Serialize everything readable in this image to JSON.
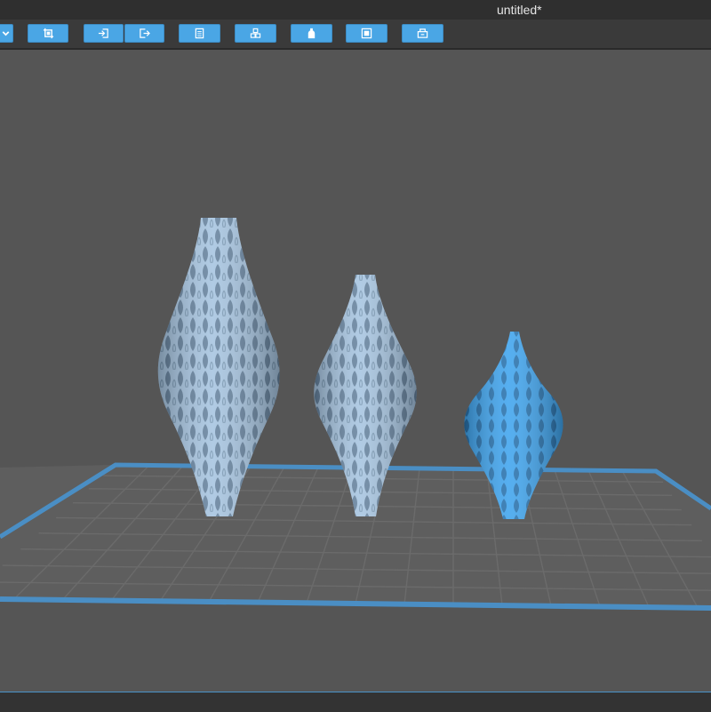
{
  "window": {
    "title": "untitled*"
  },
  "toolbar": {
    "buttons": [
      {
        "name": "dropdown-toggle-button",
        "icon": "chevron-down-icon"
      },
      {
        "name": "crop-button",
        "icon": "crop-icon"
      },
      {
        "name": "import-button",
        "icon": "import-icon"
      },
      {
        "name": "export-button",
        "icon": "export-icon"
      },
      {
        "name": "notes-button",
        "icon": "document-icon"
      },
      {
        "name": "arrange-button",
        "icon": "cubes-icon"
      },
      {
        "name": "object-button",
        "icon": "bottle-icon"
      },
      {
        "name": "view-button",
        "icon": "square-icon"
      },
      {
        "name": "print-button",
        "icon": "printer-icon"
      }
    ]
  },
  "scene": {
    "objects": [
      {
        "name": "lattice-vase-1",
        "color": "#a6c4e0",
        "selected": false
      },
      {
        "name": "lattice-vase-2",
        "color": "#a6c4e0",
        "selected": false
      },
      {
        "name": "lattice-vase-3",
        "color": "#3fa4ee",
        "selected": true
      }
    ],
    "bed_color": "#4a8ec4",
    "grid_color": "#6b6b6b"
  }
}
